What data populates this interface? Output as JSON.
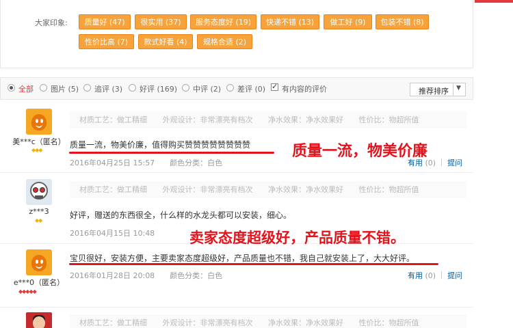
{
  "impression": {
    "label": "大家印象:",
    "tags": [
      {
        "text": "质量好 (47)"
      },
      {
        "text": "很实用 (37)"
      },
      {
        "text": "服务态度好 (19)"
      },
      {
        "text": "快递不错 (13)"
      },
      {
        "text": "做工好 (9)"
      },
      {
        "text": "包装不错 (8)"
      },
      {
        "text": "性价比高 (7)"
      },
      {
        "text": "款式好看 (4)"
      },
      {
        "text": "规格合适 (2)"
      }
    ]
  },
  "filters": {
    "options": [
      {
        "label": "全部",
        "selected": true
      },
      {
        "label": "图片 (5)",
        "selected": false
      },
      {
        "label": "追评 (3)",
        "selected": false
      },
      {
        "label": "好评 (169)",
        "selected": false
      },
      {
        "label": "中评 (2)",
        "selected": false
      },
      {
        "label": "差评 (0)",
        "selected": false
      }
    ],
    "content_only": {
      "label": "有内容的评价",
      "checked": true
    },
    "sort": {
      "label": "推荐排序"
    }
  },
  "reviews": [
    {
      "user": "美***c（匿名）",
      "badge": "◆◆◆",
      "badge_color": "#f0b400",
      "attrs": [
        "材质工艺：做工精细",
        "外观设计：非常漂亮有档次",
        "净水效果：净水效果好",
        "性价比：物超所值"
      ],
      "content": "质量一流，物美价廉，值得购买赞赞赞赞赞赞赞赞",
      "date": "2016年04月25日  15:57",
      "color": "颜色分类：白色",
      "useful": "有用",
      "useful_count": "(0)",
      "reply": "提问"
    },
    {
      "user": "z***3",
      "badge": "◆◆",
      "badge_color": "#f0b400",
      "attrs": [
        "材质工艺：做工精细",
        "外观设计：非常漂亮有档次",
        "净水效果：净水效果好",
        "性价比：物超所值"
      ],
      "content": "好评，赠送的东西很全，什么样的水龙头都可以安装，细心。",
      "date": "2016年04月15日  10:48",
      "color": "",
      "useful": "",
      "useful_count": "",
      "reply": ""
    },
    {
      "user": "e***0（匿名）",
      "badge": "◆◆◆◆◆",
      "badge_color": "#e4393c",
      "attrs": [],
      "content": "宝贝很好，安装方便，主要卖家态度超级好，产品质量也不错，我自己就安装上了，大大好评。",
      "date": "2016年01月28日  20:08",
      "color": "颜色分类：白色",
      "useful": "有用",
      "useful_count": "(0)",
      "reply": "提问"
    },
    {
      "user": "",
      "attrs": [
        "材质工艺：做工精细",
        "外观设计：非常漂亮有档次",
        "净水效果：净水效果好",
        "性价比：物超所值"
      ]
    }
  ],
  "overlays": {
    "text1": "质量一流，物美价廉",
    "text2": "卖家态度超级好，产品质量不错。"
  },
  "colors": {
    "tag_bg": "#f7a23a",
    "accent_red": "#e4393c",
    "link_blue": "#005aa0",
    "overlay_red": "#e4121b"
  }
}
